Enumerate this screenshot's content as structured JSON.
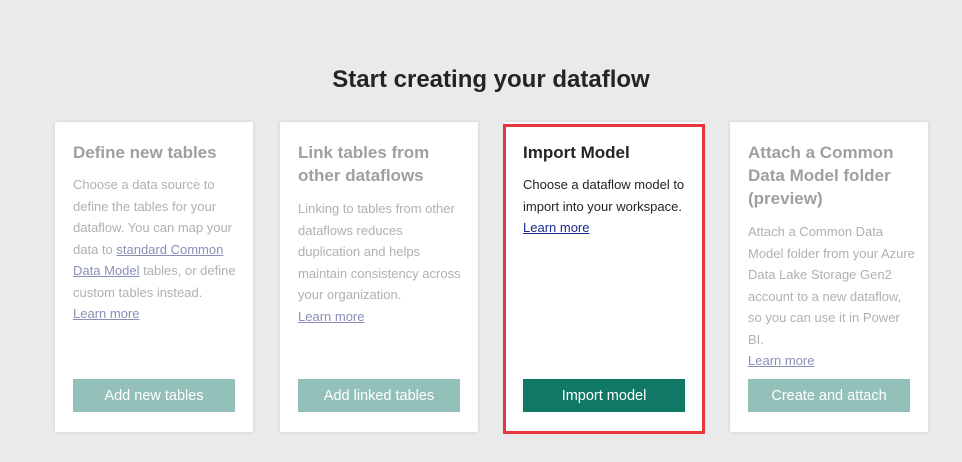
{
  "page": {
    "title": "Start creating your dataflow"
  },
  "cards": [
    {
      "heading": "Define new tables",
      "desc_pre": "Choose a data source to define the tables for your dataflow. You can map your data to ",
      "desc_link": "standard Common Data Model",
      "desc_post": " tables, or define custom tables instead.",
      "learn_more": "Learn more",
      "button": "Add new tables"
    },
    {
      "heading": "Link tables from other dataflows",
      "desc": "Linking to tables from other dataflows reduces duplication and helps maintain consistency across your organization.",
      "learn_more": "Learn more",
      "button": "Add linked tables"
    },
    {
      "heading": "Import Model",
      "desc": "Choose a dataflow model to import into your workspace.",
      "learn_more": "Learn more",
      "button": "Import model"
    },
    {
      "heading": "Attach a Common Data Model folder (preview)",
      "desc": "Attach a Common Data Model folder from your Azure Data Lake Storage Gen2 account to a new dataflow, so you can use it in Power BI.",
      "learn_more": "Learn more",
      "button": "Create and attach"
    }
  ],
  "colors": {
    "accent_active": "#117865",
    "accent_disabled": "#93c0b8",
    "highlight_border": "#e8373c"
  }
}
